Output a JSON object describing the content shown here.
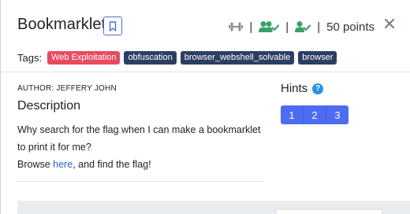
{
  "challenge": {
    "title": "Bookmarklet",
    "points_label": "50 points",
    "tags_label": "Tags:",
    "tags": [
      {
        "label": "Web Exploitation",
        "color": "#e84a5f"
      },
      {
        "label": "obfuscation",
        "color": "#2c3e63"
      },
      {
        "label": "browser_webshell_solvable",
        "color": "#2c3e63"
      },
      {
        "label": "browser",
        "color": "#2c3e63"
      }
    ],
    "author": "AUTHOR: JEFFERY JOHN",
    "description_heading": "Description",
    "description_line1": "Why search for the flag when I can make a bookmarklet to print it for me?",
    "browse_prefix": "Browse ",
    "browse_link": "here",
    "browse_suffix": ", and find the flag!"
  },
  "hints": {
    "heading": "Hints",
    "help_glyph": "?",
    "items": [
      "1",
      "2",
      "3"
    ]
  },
  "icons": {
    "bookmark": "bookmark-icon",
    "difficulty": "dumbbell-icon",
    "solvers": "users-check-icon",
    "solved": "user-check-icon",
    "close": "close-icon"
  },
  "colors": {
    "accent": "#4d6cf2",
    "success": "#38a169",
    "danger_tag": "#e84a5f",
    "dark_tag": "#2c3e63",
    "link": "#2d63c8"
  }
}
